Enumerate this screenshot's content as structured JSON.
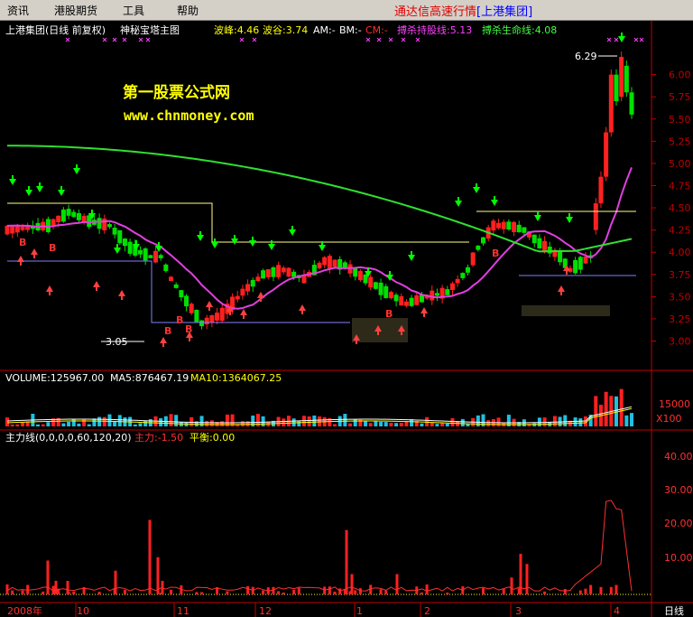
{
  "menu": {
    "items": [
      "资讯",
      "港股期货",
      "工具",
      "帮助"
    ]
  },
  "app_title": {
    "prefix": "通达信高速行情",
    "stock": "[上港集团]"
  },
  "main_panel": {
    "stock_label": "上港集团(日线 前复权)",
    "indicator_name": "神秘宝塔主图",
    "params": [
      {
        "text": "波峰:4.46",
        "color": "#ffff00"
      },
      {
        "text": "波谷:3.74",
        "color": "#ffff00"
      },
      {
        "text": "AM:-",
        "color": "#ffffff"
      },
      {
        "text": "BM:-",
        "color": "#ffffff"
      },
      {
        "text": "CM:-",
        "color": "#ff3030"
      },
      {
        "text": "搏杀持股线:5.13",
        "color": "#ff40ff"
      },
      {
        "text": "搏杀生命线:4.08",
        "color": "#40ff40"
      }
    ],
    "watermark_cn": "第一股票公式网",
    "watermark_url": "www.chnmoney.com",
    "price_ticks": [
      "6.00",
      "5.75",
      "5.50",
      "5.25",
      "5.00",
      "4.75",
      "4.50",
      "4.25",
      "4.00",
      "3.75",
      "3.50",
      "3.25",
      "3.00"
    ],
    "high_label": "6.29",
    "low_label": "3.05",
    "buy_labels": [
      "B",
      "B",
      "B",
      "B",
      "B",
      "B",
      "B"
    ]
  },
  "volume_panel": {
    "volume_label": "VOLUME:125967.00",
    "ma5_label": "MA5:876467.19",
    "ma10_label": "MA10:1364067.25",
    "tick": "15000",
    "unit": "X100"
  },
  "force_panel": {
    "name": "主力线(0,0,0,0,60,120,20)",
    "main_force": "主力:-1.50",
    "balance": "平衡:0.00",
    "ticks": [
      "40.00",
      "30.00",
      "20.00",
      "10.00"
    ]
  },
  "date_axis": {
    "labels": [
      "2008年",
      "10",
      "11",
      "12",
      "1",
      "2",
      "3",
      "4"
    ]
  },
  "period": "日线",
  "colors": {
    "up": "#ff2020",
    "down": "#00e000",
    "flat": "#ffff00",
    "ma_long": "#30e030",
    "ma_mid": "#e040e0",
    "axis": "#c00000",
    "background": "#000000"
  }
}
